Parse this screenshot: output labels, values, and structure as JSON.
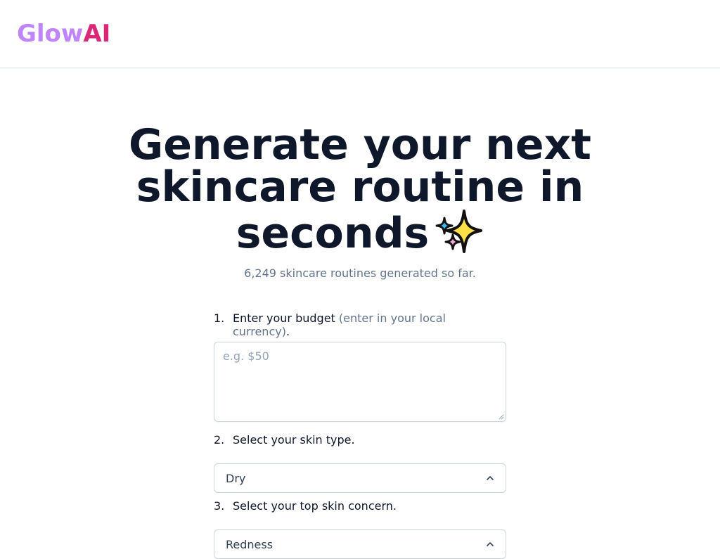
{
  "brand": {
    "part1": "Glow",
    "part2": "AI"
  },
  "hero": {
    "line1": "Generate your next",
    "line2": "skincare routine in",
    "line3": "seconds"
  },
  "counter_text": "6,249 skincare routines generated so far.",
  "steps": [
    {
      "num": "1.",
      "label": "Enter your budget",
      "note": "(enter in your local currency)",
      "tail": "."
    },
    {
      "num": "2.",
      "label": "Select your skin type."
    },
    {
      "num": "3.",
      "label": "Select your top skin concern."
    }
  ],
  "budget": {
    "placeholder": "e.g. $50",
    "value": ""
  },
  "skin_type": {
    "selected": "Dry"
  },
  "skin_concern": {
    "selected": "Redness"
  },
  "colors": {
    "brand_light": "#c084fc",
    "brand_dark": "#db2777",
    "heading": "#0f172a",
    "muted": "#64748b"
  },
  "icons": [
    "sparkles-icon",
    "chevron-up-icon"
  ]
}
